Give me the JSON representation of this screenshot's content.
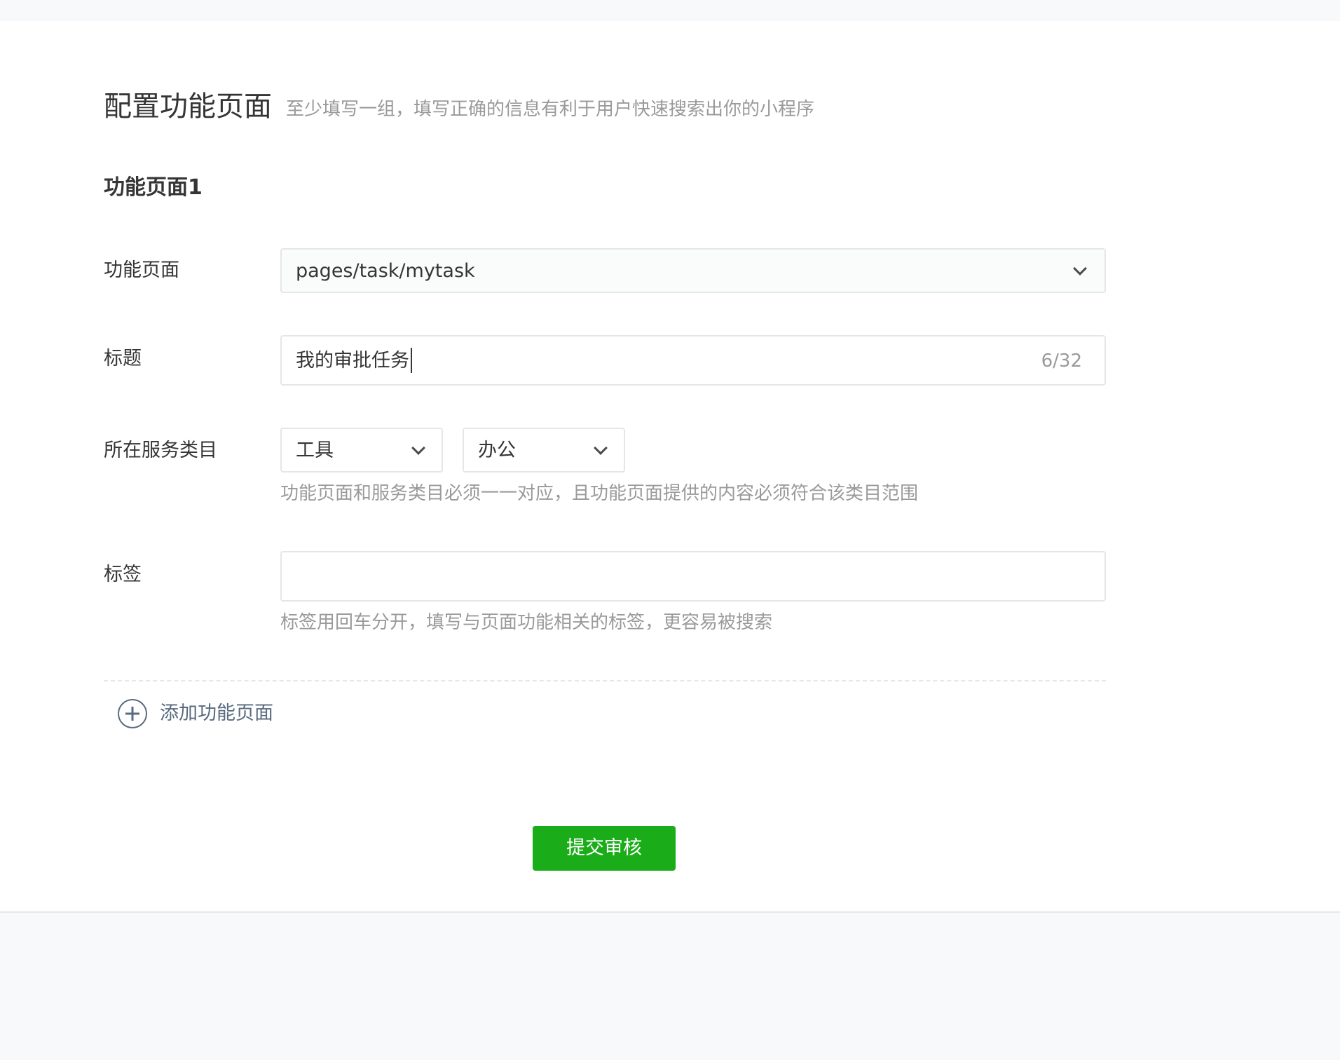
{
  "header": {
    "title": "配置功能页面",
    "description": "至少填写一组，填写正确的信息有利于用户快速搜索出你的小程序"
  },
  "section": {
    "title": "功能页面1"
  },
  "form": {
    "page": {
      "label": "功能页面",
      "value": "pages/task/mytask"
    },
    "title": {
      "label": "标题",
      "value": "我的审批任务",
      "counter": "6/32"
    },
    "category": {
      "label": "所在服务类目",
      "primary": "工具",
      "secondary": "办公",
      "hint": "功能页面和服务类目必须一一对应，且功能页面提供的内容必须符合该类目范围"
    },
    "tags": {
      "label": "标签",
      "value": "",
      "hint": "标签用回车分开，填写与页面功能相关的标签，更容易被搜索"
    }
  },
  "actions": {
    "add_page_label": "添加功能页面",
    "submit_label": "提交审核"
  },
  "colors": {
    "primary_green": "#1aad19",
    "hint_gray": "#9a9a9a",
    "link_slate": "#5a6a80"
  },
  "icons": {
    "dropdown": "chevron-down-icon",
    "add": "plus-circle-icon"
  }
}
